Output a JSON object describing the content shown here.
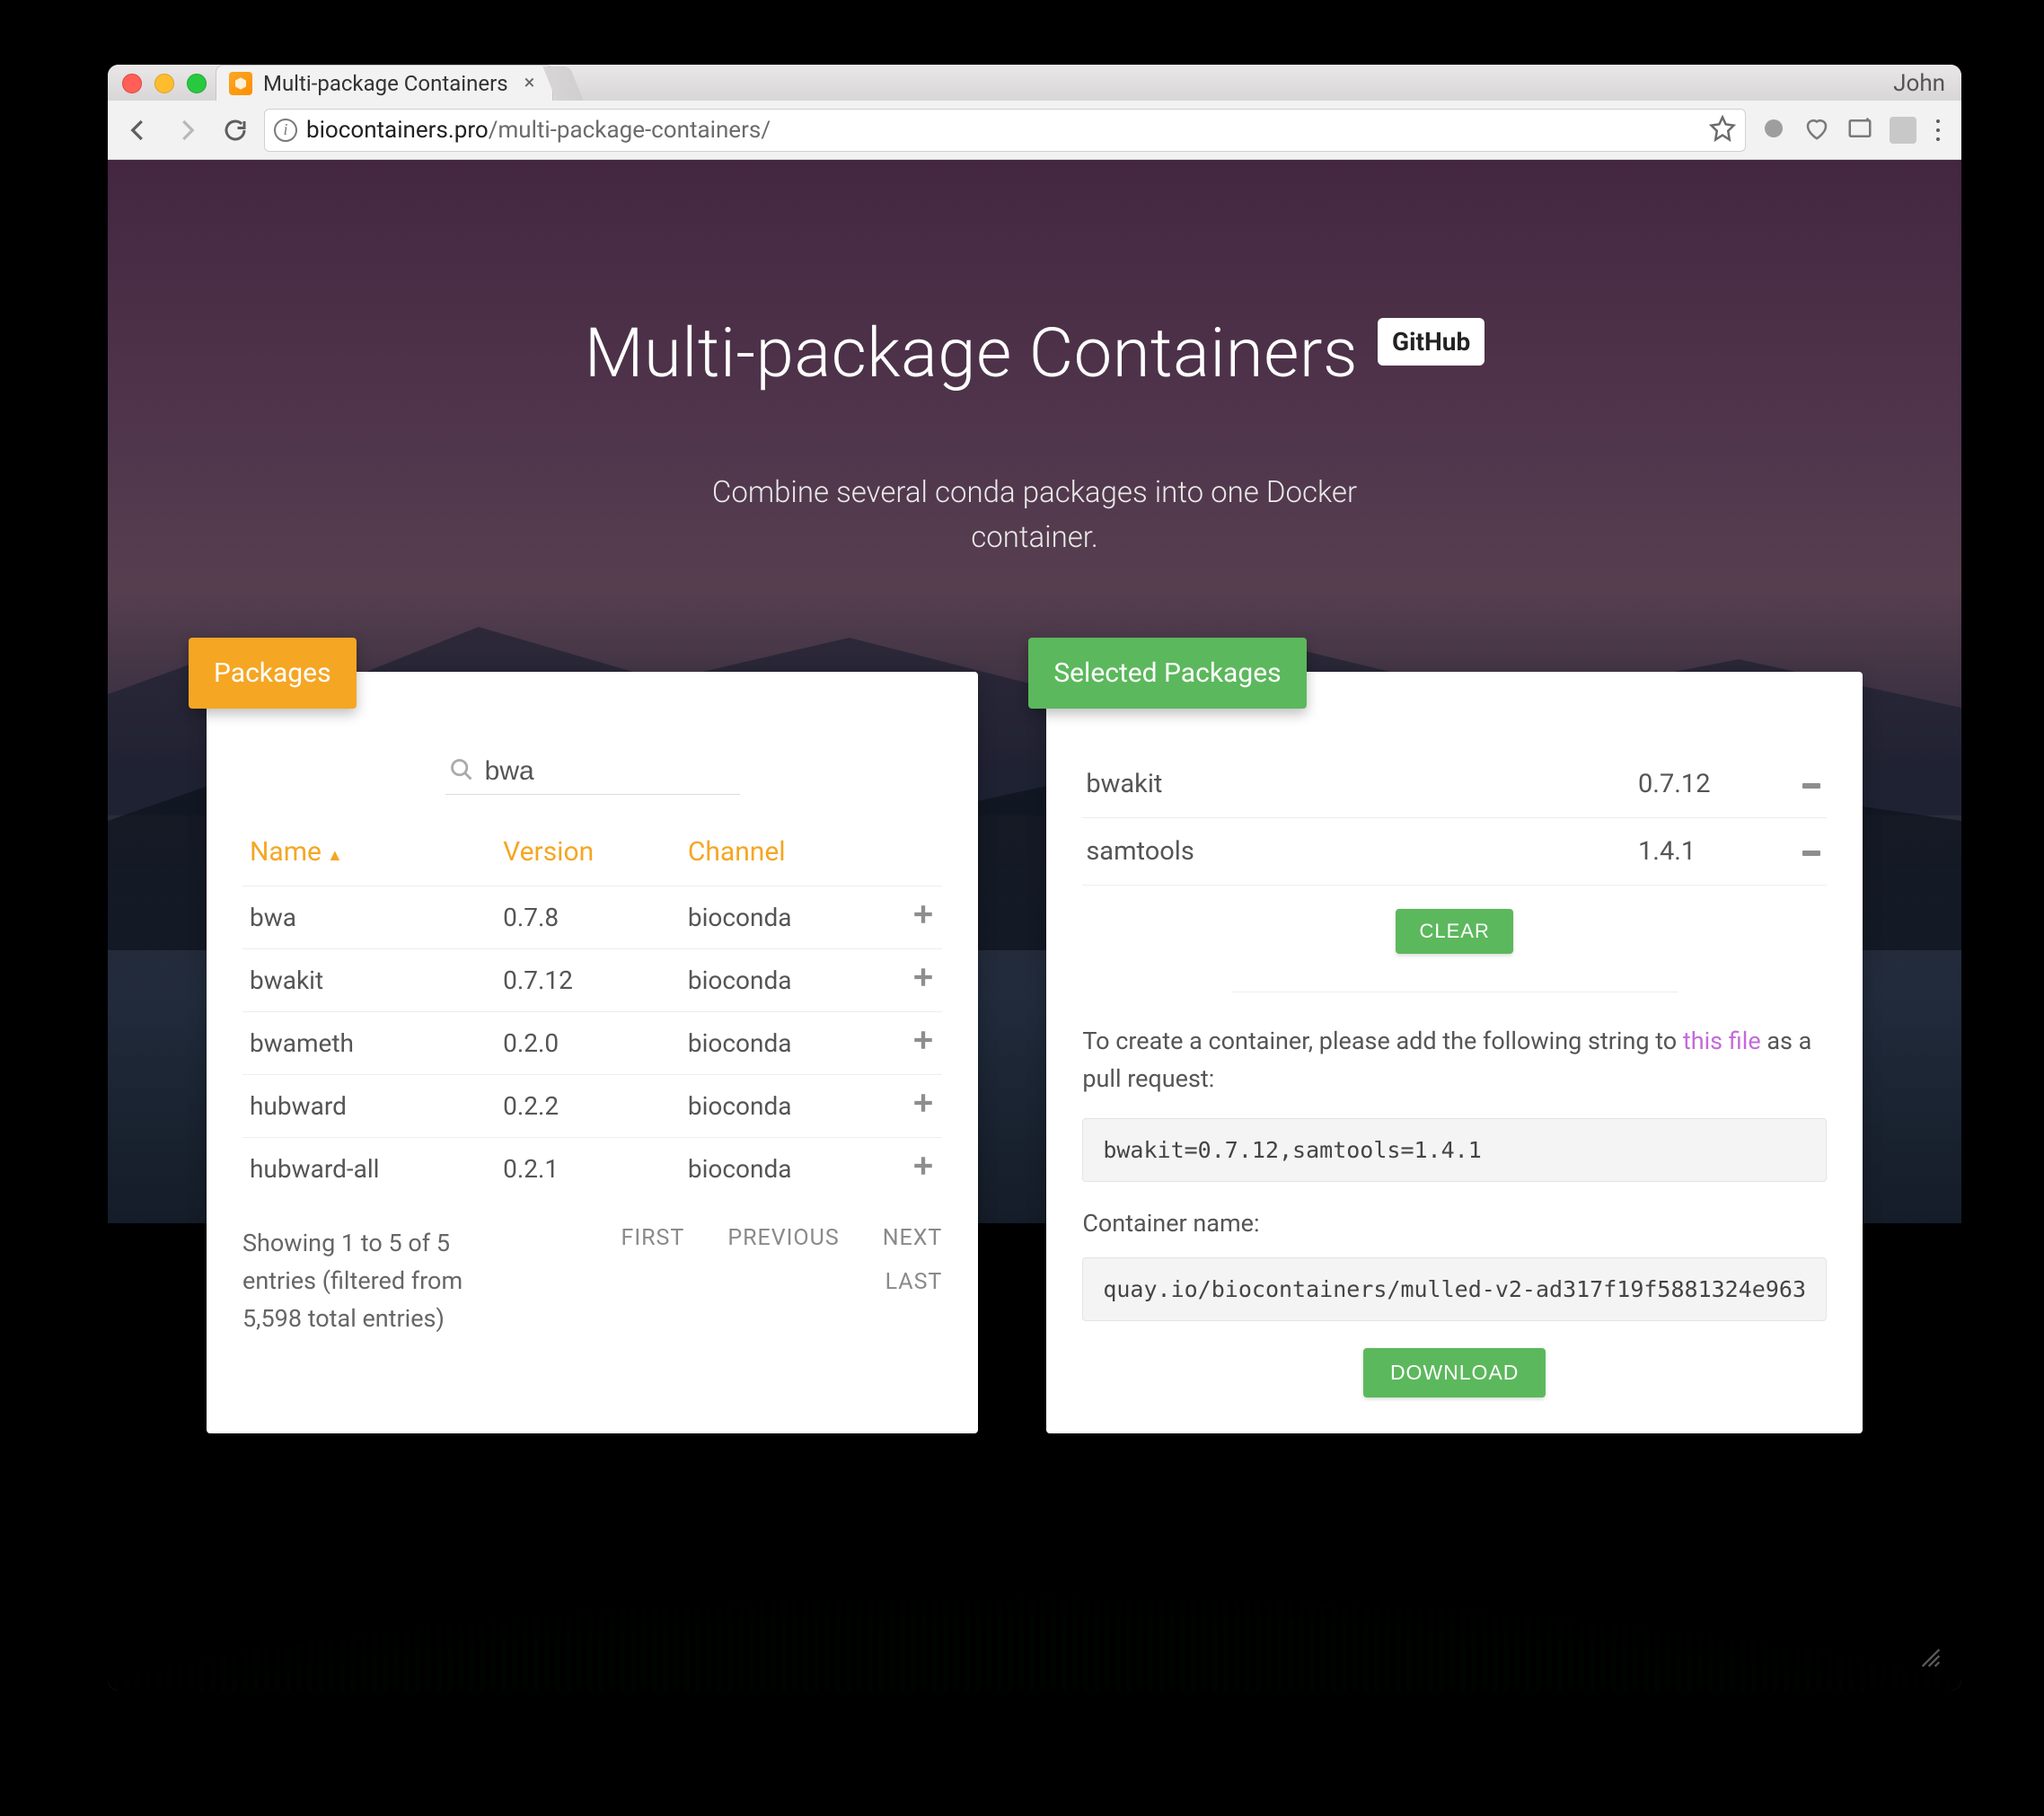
{
  "browser": {
    "profile_name": "John",
    "tab_title": "Multi-package Containers",
    "url_domain": "biocontainers.pro",
    "url_path": "/multi-package-containers/"
  },
  "hero": {
    "title": "Multi-package Containers",
    "github_label": "GitHub",
    "subtitle_line1": "Combine several conda packages into one Docker",
    "subtitle_line2": "container."
  },
  "packages_card": {
    "chip": "Packages",
    "search_value": "bwa",
    "columns": {
      "name": "Name",
      "version": "Version",
      "channel": "Channel"
    },
    "rows": [
      {
        "name": "bwa",
        "version": "0.7.8",
        "channel": "bioconda"
      },
      {
        "name": "bwakit",
        "version": "0.7.12",
        "channel": "bioconda"
      },
      {
        "name": "bwameth",
        "version": "0.2.0",
        "channel": "bioconda"
      },
      {
        "name": "hubward",
        "version": "0.2.2",
        "channel": "bioconda"
      },
      {
        "name": "hubward-all",
        "version": "0.2.1",
        "channel": "bioconda"
      }
    ],
    "info_text": "Showing 1 to 5 of 5 entries (filtered from 5,598 total entries)",
    "pager": {
      "first": "FIRST",
      "previous": "PREVIOUS",
      "next": "NEXT",
      "last": "LAST"
    }
  },
  "selected_card": {
    "chip": "Selected Packages",
    "rows": [
      {
        "name": "bwakit",
        "version": "0.7.12"
      },
      {
        "name": "samtools",
        "version": "1.4.1"
      }
    ],
    "clear_label": "CLEAR",
    "instruction_pre": "To create a container, please add the following string to ",
    "instruction_link": "this file",
    "instruction_post": " as a pull request:",
    "package_string": "bwakit=0.7.12,samtools=1.4.1",
    "container_label": "Container name:",
    "container_name": "quay.io/biocontainers/mulled-v2-ad317f19f5881324e963",
    "download_label": "DOWNLOAD"
  }
}
